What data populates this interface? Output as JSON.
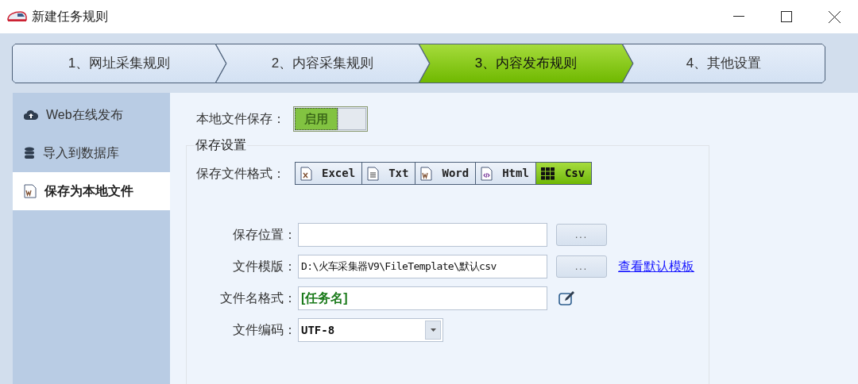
{
  "window": {
    "title": "新建任务规则"
  },
  "steps": [
    {
      "label": "1、网址采集规则",
      "selected": false
    },
    {
      "label": "2、内容采集规则",
      "selected": false
    },
    {
      "label": "3、内容发布规则",
      "selected": true
    },
    {
      "label": "4、其他设置",
      "selected": false
    }
  ],
  "sidebar": {
    "items": [
      {
        "label": "Web在线发布",
        "kind": "cloud",
        "selected": false
      },
      {
        "label": "导入到数据库",
        "kind": "database",
        "selected": false
      },
      {
        "label": "保存为本地文件",
        "kind": "file",
        "selected": true
      }
    ]
  },
  "local_save": {
    "label": "本地文件保存：",
    "toggle": {
      "label": "启用",
      "on": true
    }
  },
  "group": {
    "title": "保存设置",
    "format": {
      "label": "保存文件格式：",
      "options": [
        {
          "label": "Excel",
          "kind": "excel",
          "selected": false
        },
        {
          "label": "Txt",
          "kind": "txt",
          "selected": false
        },
        {
          "label": "Word",
          "kind": "word",
          "selected": false
        },
        {
          "label": "Html",
          "kind": "html",
          "selected": false
        },
        {
          "label": "Csv",
          "kind": "csv",
          "selected": true
        }
      ]
    },
    "fields": [
      {
        "label": "保存位置：",
        "kind": "browse",
        "button": "..."
      },
      {
        "label": "文件模版：",
        "kind": "browse",
        "value": "D:\\火车采集器V9\\FileTemplate\\默认csv",
        "button": "...",
        "link": "查看默认模板"
      },
      {
        "label": "文件名格式：",
        "kind": "edit",
        "value": "[任务名]"
      },
      {
        "label": "文件编码：",
        "kind": "select",
        "value": "UTF-8"
      }
    ]
  }
}
